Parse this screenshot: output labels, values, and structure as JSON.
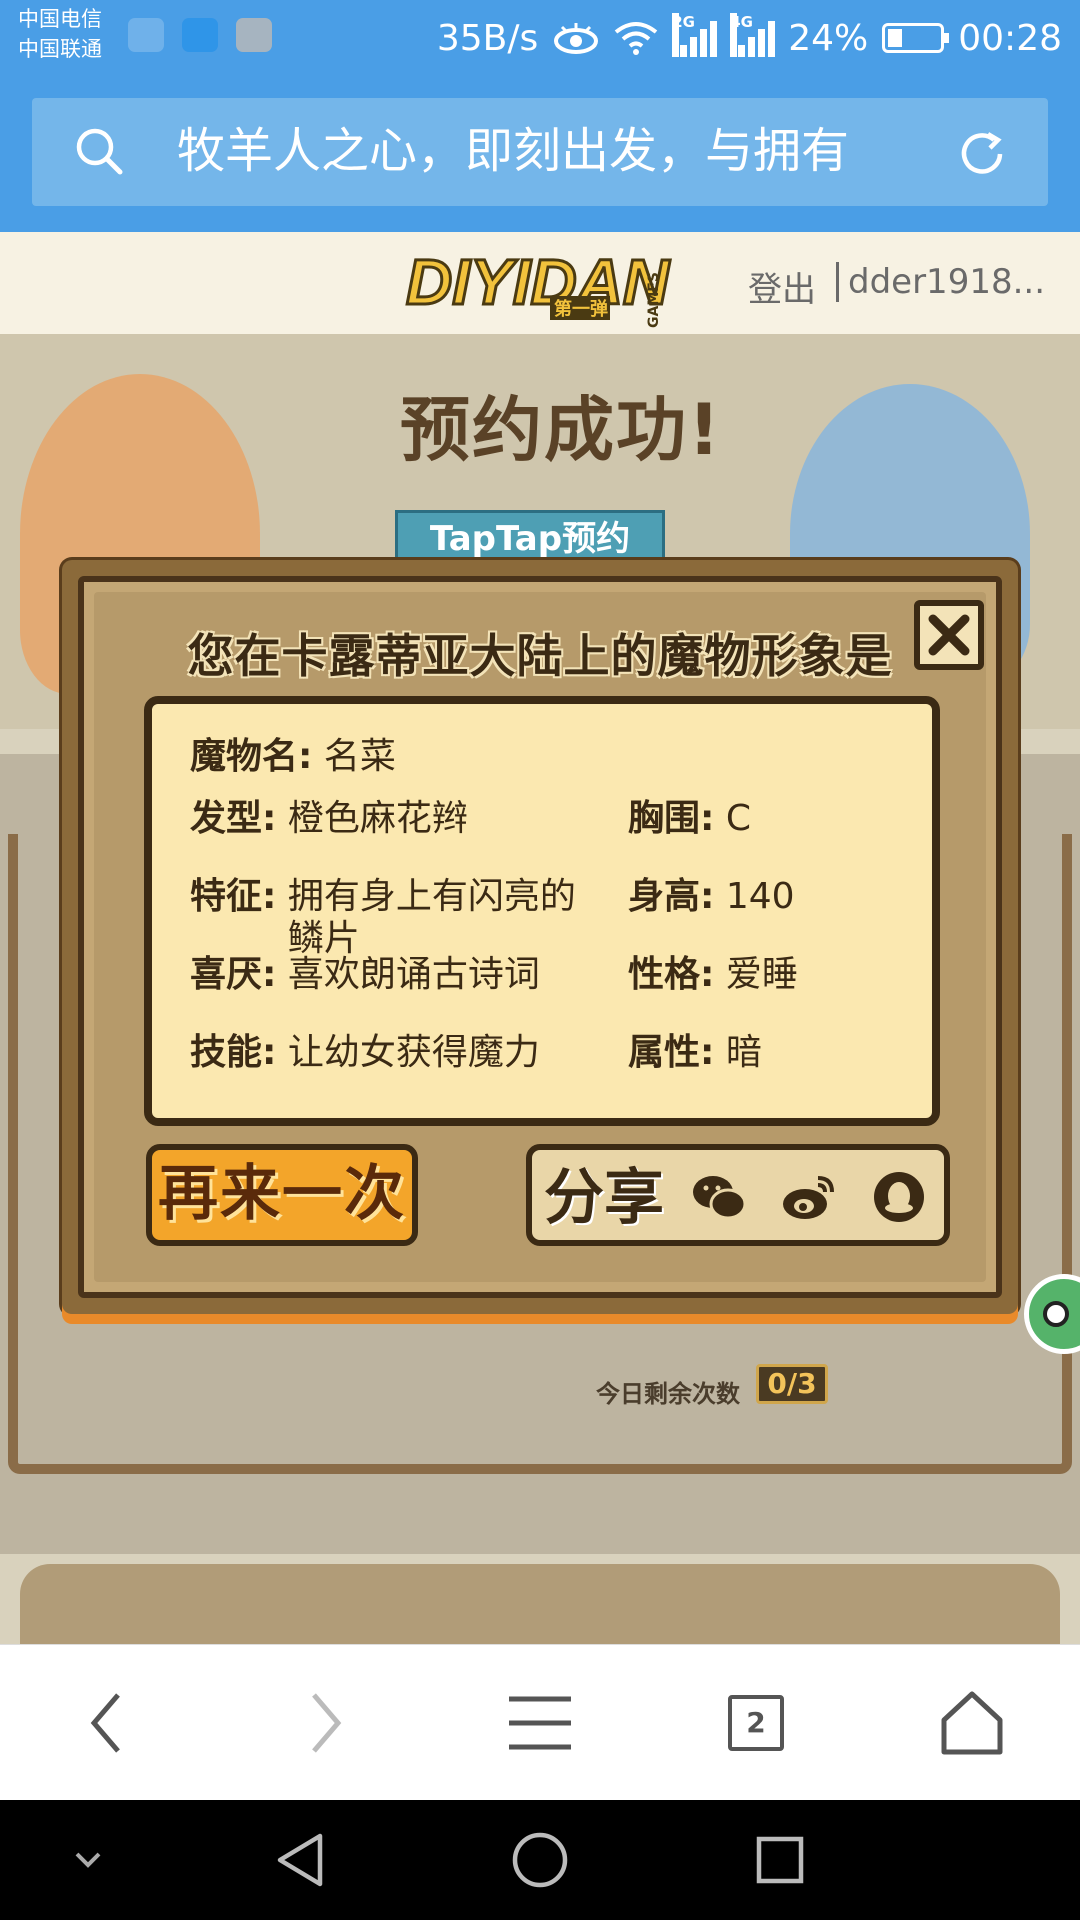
{
  "status_bar": {
    "carrier_1": "中国电信",
    "carrier_2": "中国联通",
    "speed": "35B/s",
    "network_1": "2G",
    "network_2": "4G",
    "battery": "24%",
    "time": "00:28",
    "icons": [
      "health-icon",
      "message-icon",
      "gallery-icon",
      "eye-icon",
      "wifi-icon",
      "signal-icon",
      "battery-icon"
    ]
  },
  "search": {
    "text": "牧羊人之心，即刻出发，与拥有"
  },
  "site_header": {
    "logo_text": "DIYIDAN",
    "logo_sub": "第一弹",
    "logo_games": "GAMES",
    "logout": "登出",
    "username": "dder1918..."
  },
  "background": {
    "banner_title": "预约成功!",
    "taptap": "TapTap预约",
    "remaining_label": "今日剩余次数",
    "remaining_count": "0/3"
  },
  "modal": {
    "title": "您在卡露蒂亚大陆上的魔物形象是",
    "fields": {
      "name_label": "魔物名:",
      "name_value": "名菜",
      "hair_label": "发型:",
      "hair_value": "橙色麻花辫",
      "bust_label": "胸围:",
      "bust_value": "C",
      "feature_label": "特征:",
      "feature_value": "拥有身上有闪亮的鳞片",
      "height_label": "身高:",
      "height_value": "140",
      "likes_label": "喜厌:",
      "likes_value": "喜欢朗诵古诗词",
      "personality_label": "性格:",
      "personality_value": "爱睡",
      "skill_label": "技能:",
      "skill_value": "让幼女获得魔力",
      "attribute_label": "属性:",
      "attribute_value": "暗"
    },
    "retry_label": "再来一次",
    "share_label": "分享"
  },
  "browser_bar": {
    "tab_count": "2"
  },
  "colors": {
    "status_blue": "#4a9ee6",
    "modal_paper": "#fbe8b0",
    "modal_border": "#3b2a14",
    "retry_orange": "#f3a52a"
  }
}
